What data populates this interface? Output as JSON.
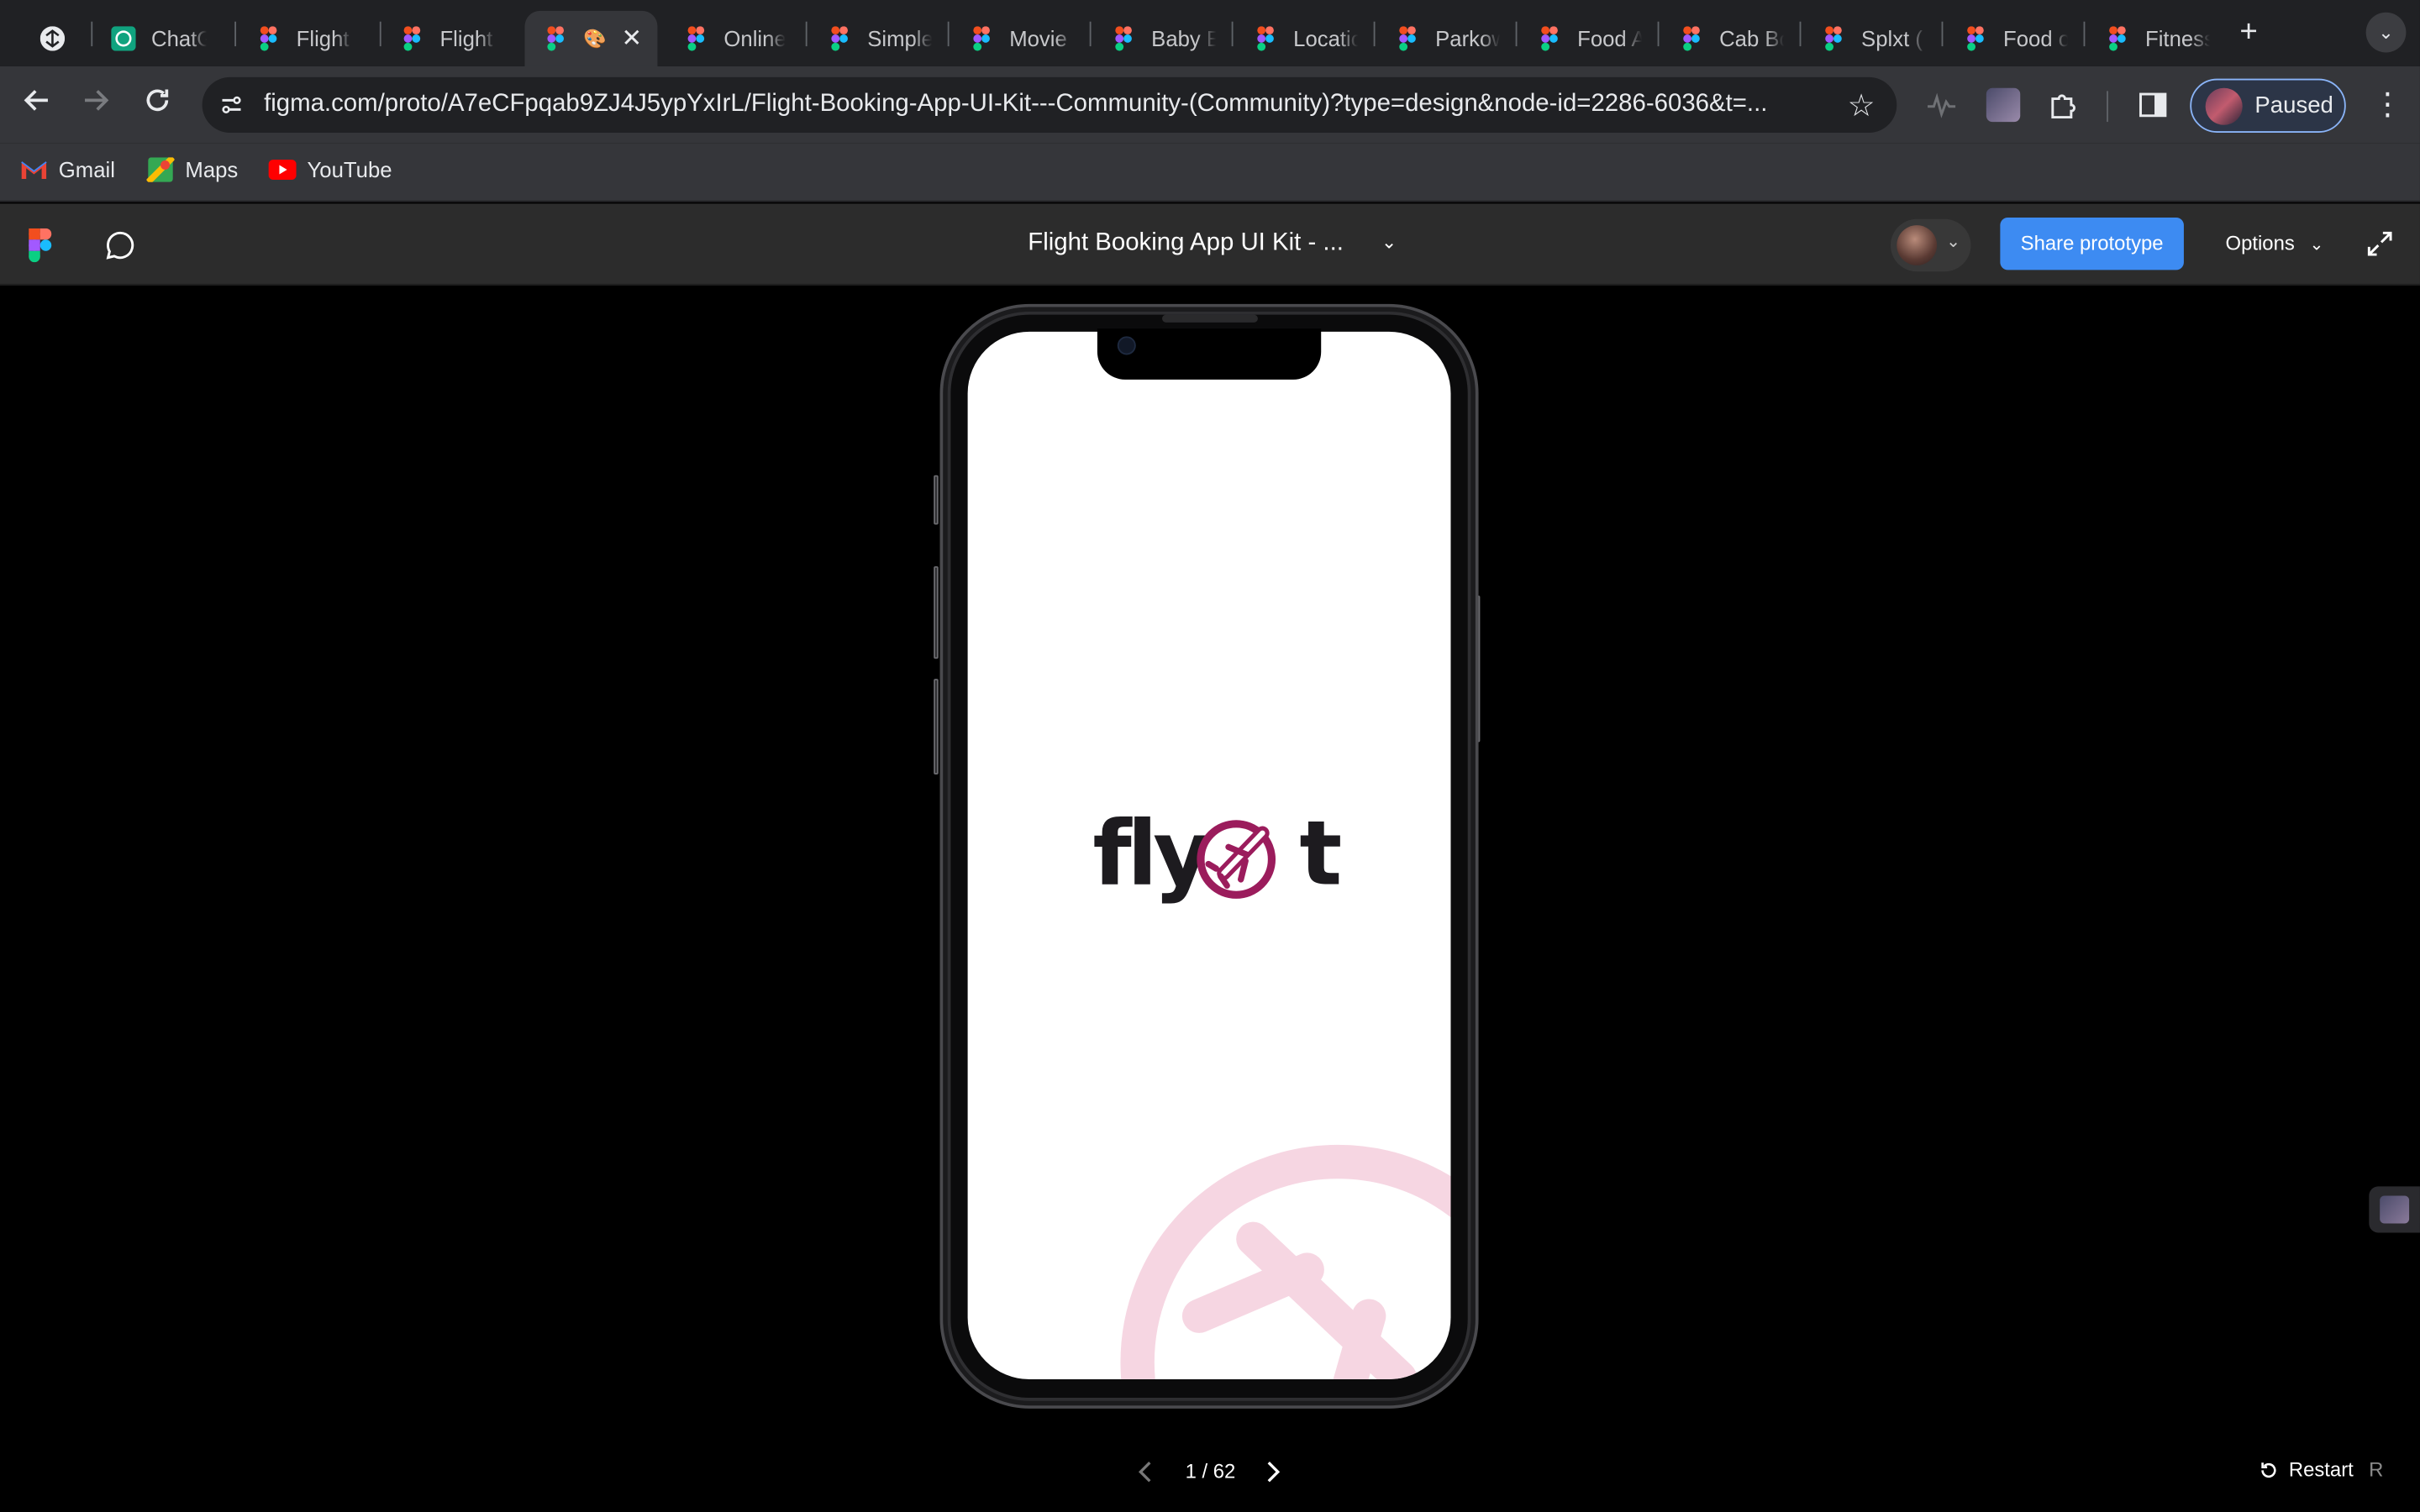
{
  "browser": {
    "tabs": [
      {
        "label": "",
        "favicon": "perplexity-icon"
      },
      {
        "label": "ChatGPT",
        "favicon": "chatgpt-icon"
      },
      {
        "label": "Flight Booking",
        "favicon": "figma-icon"
      },
      {
        "label": "Flight Booking",
        "favicon": "figma-icon"
      },
      {
        "label": "🎨",
        "favicon": "figma-icon",
        "active": true
      },
      {
        "label": "Online",
        "favicon": "figma-icon"
      },
      {
        "label": "Simple",
        "favicon": "figma-icon"
      },
      {
        "label": "Movie",
        "favicon": "figma-icon"
      },
      {
        "label": "Baby E",
        "favicon": "figma-icon"
      },
      {
        "label": "Locatio",
        "favicon": "figma-icon"
      },
      {
        "label": "Parkow",
        "favicon": "figma-icon"
      },
      {
        "label": "Food A",
        "favicon": "figma-icon"
      },
      {
        "label": "Cab Bo",
        "favicon": "figma-icon"
      },
      {
        "label": "Splxt (",
        "favicon": "figma-icon"
      },
      {
        "label": "Food o",
        "favicon": "figma-icon"
      },
      {
        "label": "Fitness",
        "favicon": "figma-icon"
      }
    ],
    "url": "figma.com/proto/A7eCFpqab9ZJ4J5ypYxIrL/Flight-Booking-App-UI-Kit---Community-(Community)?type=design&node-id=2286-6036&t=...",
    "profile_label": "Paused",
    "bookmarks": [
      {
        "label": "Gmail",
        "icon": "gmail-icon"
      },
      {
        "label": "Maps",
        "icon": "maps-icon"
      },
      {
        "label": "YouTube",
        "icon": "youtube-icon"
      }
    ]
  },
  "figma": {
    "file_title": "Flight Booking App UI Kit - ...",
    "share_label": "Share prototype",
    "options_label": "Options",
    "accent_color": "#3d8bf2"
  },
  "prototype": {
    "logo_left": "fly",
    "logo_right": "t",
    "brand_color": "#9b1c5c",
    "pager": "1 / 62",
    "restart_label": "Restart",
    "restart_key": "R"
  }
}
